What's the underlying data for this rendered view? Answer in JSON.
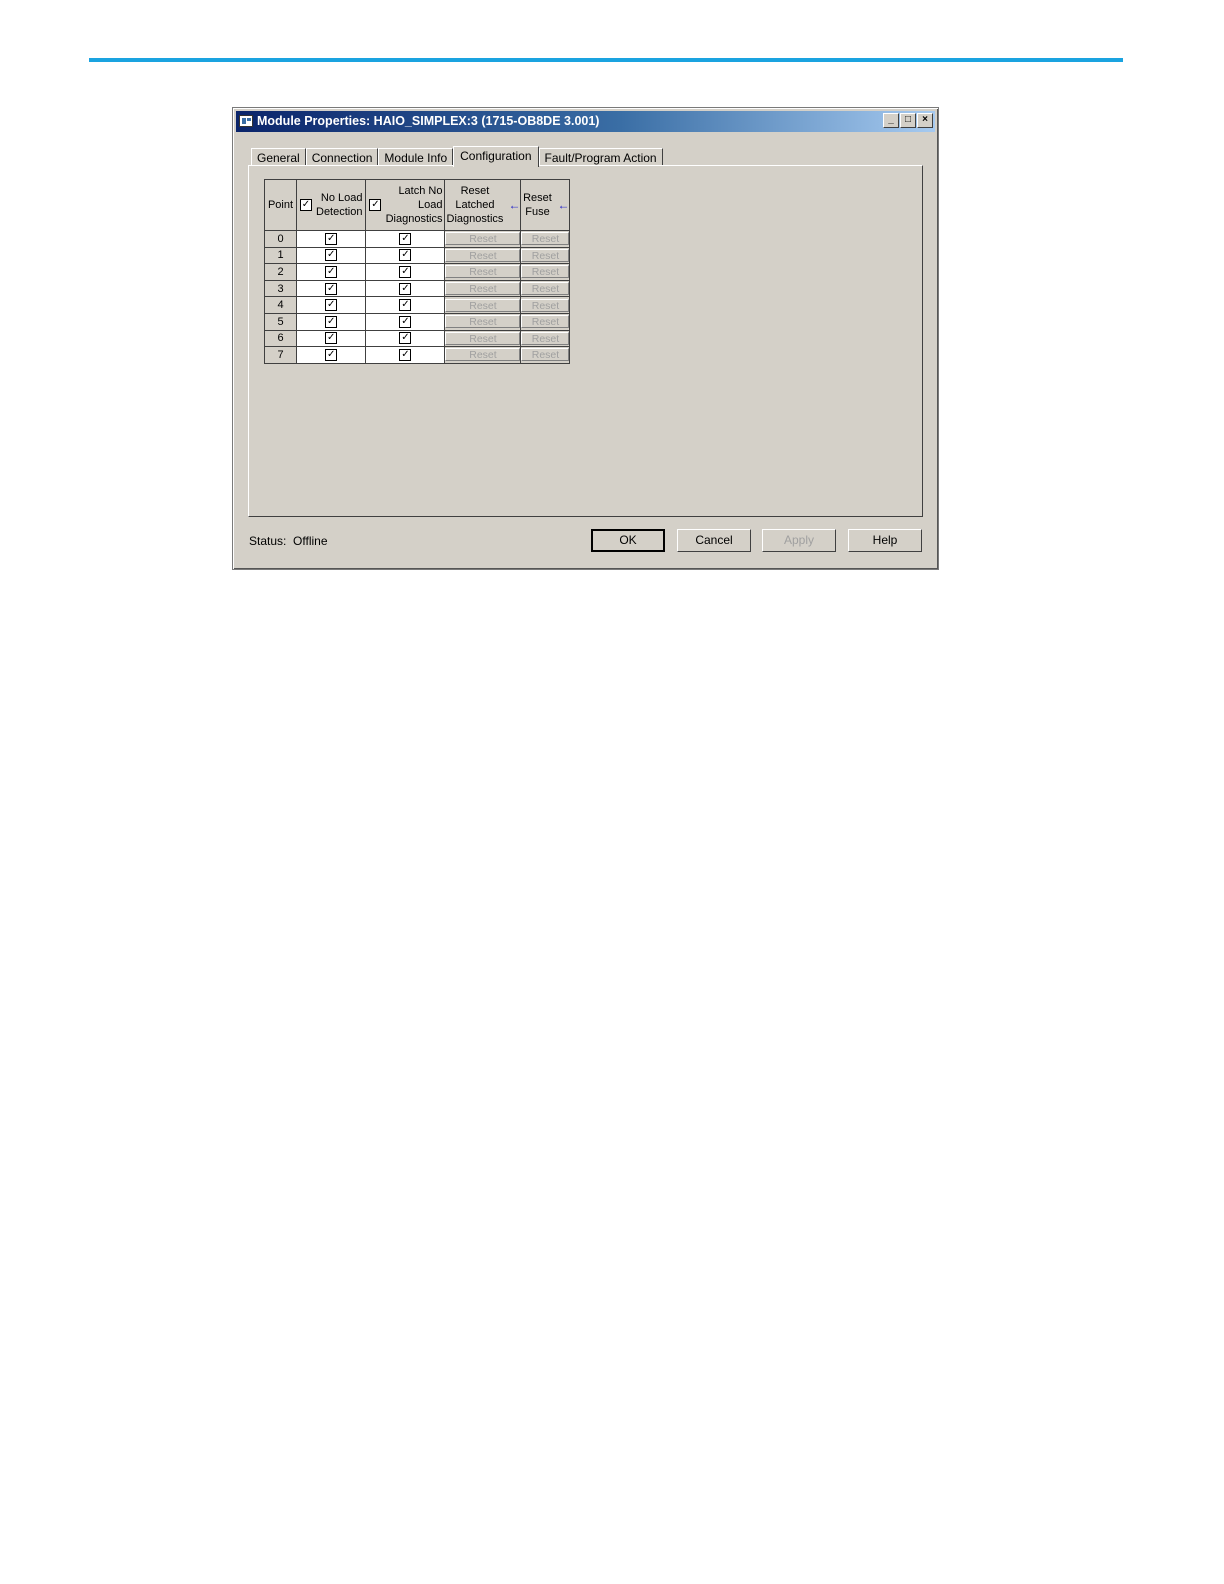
{
  "window": {
    "title": "Module Properties: HAIO_SIMPLEX:3 (1715-OB8DE 3.001)",
    "controls": {
      "minimize": "_",
      "maximize": "□",
      "close": "×"
    }
  },
  "tabs": [
    {
      "label": "General",
      "active": false
    },
    {
      "label": "Connection",
      "active": false
    },
    {
      "label": "Module Info",
      "active": false
    },
    {
      "label": "Configuration",
      "active": true
    },
    {
      "label": "Fault/Program Action",
      "active": false
    }
  ],
  "table": {
    "headers": {
      "point": "Point",
      "no_load_detection": "No Load Detection",
      "latch_no_load": "Latch No Load Diagnostics",
      "reset_latched": "Reset Latched Diagnostics",
      "reset_fuse": "Reset Fuse"
    },
    "header_checks": {
      "no_load_detection": true,
      "latch_no_load": true
    },
    "check_glyph": "✓",
    "arrow_glyph": "←",
    "rows": [
      {
        "point": "0",
        "no_load_detection": true,
        "latch_no_load": true,
        "reset_latched": "Reset",
        "reset_fuse": "Reset"
      },
      {
        "point": "1",
        "no_load_detection": true,
        "latch_no_load": true,
        "reset_latched": "Reset",
        "reset_fuse": "Reset"
      },
      {
        "point": "2",
        "no_load_detection": true,
        "latch_no_load": true,
        "reset_latched": "Reset",
        "reset_fuse": "Reset"
      },
      {
        "point": "3",
        "no_load_detection": true,
        "latch_no_load": true,
        "reset_latched": "Reset",
        "reset_fuse": "Reset"
      },
      {
        "point": "4",
        "no_load_detection": true,
        "latch_no_load": true,
        "reset_latched": "Reset",
        "reset_fuse": "Reset"
      },
      {
        "point": "5",
        "no_load_detection": true,
        "latch_no_load": true,
        "reset_latched": "Reset",
        "reset_fuse": "Reset"
      },
      {
        "point": "6",
        "no_load_detection": true,
        "latch_no_load": true,
        "reset_latched": "Reset",
        "reset_fuse": "Reset"
      },
      {
        "point": "7",
        "no_load_detection": true,
        "latch_no_load": true,
        "reset_latched": "Reset",
        "reset_fuse": "Reset"
      }
    ]
  },
  "status": {
    "label": "Status:",
    "value": "Offline"
  },
  "buttons": {
    "ok": "OK",
    "cancel": "Cancel",
    "apply": "Apply",
    "help": "Help"
  },
  "colors": {
    "accent_rule": "#1aa3e0",
    "titlebar_start": "#0a246a",
    "dialog_face": "#d4d0c8"
  }
}
